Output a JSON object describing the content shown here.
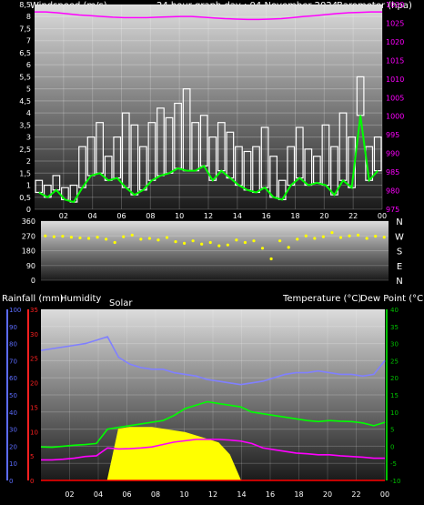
{
  "colors": {
    "background": "#000000",
    "wind_avg": "#00ff00",
    "wind_gust": "#ffffff",
    "barometer": "#ff00ff",
    "wind_dir": "#ffff00",
    "rain_axis": "#5c6cff",
    "humidity_axis": "#ff2020",
    "temp_axis": "#00c000",
    "temperature": "#00ff00",
    "dew_point": "#ff00ff",
    "humidity": "#8080ff",
    "solar": "#ffff00",
    "rain": "#ff0000",
    "grid": "#ffffff"
  },
  "header": {
    "wind_label": "Windspeed (m/s)",
    "graph_title": "24 hour graph day : 04 November 2024",
    "baro_label": "Barometer (hpa)"
  },
  "middle": {
    "rain_label": "Rainfall (mm)",
    "humidity_label": "Humidity",
    "solar_label": "Solar",
    "temp_label": "Temperature (°C)",
    "dew_label": "Dew Point (°C)"
  },
  "chart_data": [
    {
      "type": "line",
      "title": "24 hour graph day : 04 November 2024",
      "x_ticks": [
        "02",
        "04",
        "06",
        "08",
        "10",
        "12",
        "14",
        "16",
        "18",
        "20",
        "22",
        "00"
      ],
      "y_left": {
        "label": "Windspeed (m/s)",
        "range": [
          0,
          8.5
        ],
        "ticks": [
          "0",
          "0,5",
          "1",
          "1,5",
          "2",
          "2,5",
          "3",
          "3,5",
          "4",
          "4,5",
          "5",
          "5,5",
          "6",
          "6,5",
          "7",
          "7,5",
          "8",
          "8,5"
        ]
      },
      "y_right": {
        "label": "Barometer (hpa)",
        "range": [
          975,
          1030
        ],
        "ticks": [
          "975",
          "980",
          "985",
          "990",
          "995",
          "1000",
          "1005",
          "1010",
          "1015",
          "1020",
          "1025",
          "1030"
        ]
      },
      "series": [
        {
          "name": "gust",
          "axis": "left",
          "values": [
            1.2,
            1.0,
            1.4,
            0.9,
            1.0,
            2.6,
            3.0,
            3.6,
            2.2,
            3.0,
            4.0,
            3.5,
            2.6,
            3.6,
            4.2,
            3.8,
            4.4,
            5.0,
            3.6,
            3.9,
            3.0,
            3.6,
            3.2,
            2.6,
            2.4,
            2.6,
            3.4,
            2.2,
            1.2,
            2.6,
            3.4,
            2.5,
            2.2,
            3.5,
            2.6,
            4.0,
            3.0,
            5.5,
            2.6,
            3.0
          ]
        },
        {
          "name": "average",
          "axis": "left",
          "values": [
            0.7,
            0.5,
            0.8,
            0.4,
            0.3,
            0.9,
            1.4,
            1.5,
            1.2,
            1.3,
            0.9,
            0.6,
            0.8,
            1.2,
            1.4,
            1.5,
            1.7,
            1.6,
            1.6,
            1.8,
            1.2,
            1.6,
            1.3,
            1.0,
            0.8,
            0.7,
            0.9,
            0.5,
            0.4,
            1.0,
            1.3,
            1.0,
            1.1,
            1.0,
            0.6,
            1.2,
            0.9,
            3.9,
            1.2,
            1.6
          ]
        },
        {
          "name": "barometer",
          "axis": "right",
          "values": [
            1028,
            1028,
            1027.8,
            1027.5,
            1027.2,
            1027,
            1026.8,
            1026.6,
            1026.5,
            1026.5,
            1026.5,
            1026.6,
            1026.7,
            1026.8,
            1026.8,
            1026.6,
            1026.4,
            1026.2,
            1026.1,
            1026.0,
            1026.0,
            1026.1,
            1026.2,
            1026.5,
            1026.8,
            1027.0,
            1027.3,
            1027.6,
            1027.8,
            1027.9,
            1028.0,
            1028.0
          ]
        }
      ]
    },
    {
      "type": "scatter",
      "x_ticks": [
        "02",
        "04",
        "06",
        "08",
        "10",
        "12",
        "14",
        "16",
        "18",
        "20",
        "22",
        "00"
      ],
      "y_left": {
        "range": [
          0,
          360
        ],
        "ticks": [
          "0",
          "90",
          "180",
          "270",
          "360"
        ]
      },
      "y_right_labels": [
        "N",
        "W",
        "S",
        "E",
        "N"
      ],
      "series": [
        {
          "name": "wind direction",
          "values": [
            270,
            265,
            268,
            262,
            258,
            255,
            262,
            250,
            230,
            265,
            275,
            250,
            255,
            245,
            260,
            235,
            225,
            240,
            220,
            230,
            210,
            215,
            245,
            230,
            240,
            195,
            130,
            240,
            200,
            250,
            270,
            255,
            265,
            290,
            260,
            270,
            275,
            255,
            268,
            262
          ]
        }
      ]
    },
    {
      "type": "line",
      "x_ticks": [
        "02",
        "04",
        "06",
        "08",
        "10",
        "12",
        "14",
        "16",
        "18",
        "20",
        "22",
        "00"
      ],
      "y_axes": [
        {
          "label": "Rainfall (mm)",
          "range": [
            0,
            100
          ],
          "ticks": [
            "0",
            "10",
            "20",
            "30",
            "40",
            "50",
            "60",
            "70",
            "80",
            "90",
            "100"
          ]
        },
        {
          "label": "Humidity",
          "range": [
            0,
            35
          ],
          "ticks": [
            "0",
            "5",
            "10",
            "15",
            "20",
            "25",
            "30",
            "35"
          ]
        },
        {
          "label": "Temperature (°C)",
          "range": [
            -10,
            40
          ],
          "ticks": [
            "-10",
            "-5",
            "0",
            "5",
            "10",
            "15",
            "20",
            "25",
            "30",
            "35",
            "40"
          ]
        }
      ],
      "series": [
        {
          "name": "humidity",
          "values": [
            76,
            77,
            78,
            79,
            80,
            82,
            84,
            72,
            68,
            66,
            65,
            65,
            63,
            62,
            61,
            59,
            58,
            57,
            56,
            57,
            58,
            60,
            62,
            63,
            63,
            64,
            63,
            62,
            62,
            61,
            62,
            70
          ]
        },
        {
          "name": "temperature",
          "values": [
            -0.2,
            -0.3,
            0.0,
            0.3,
            0.5,
            0.8,
            5.0,
            5.5,
            6.0,
            6.5,
            7.0,
            7.5,
            9.0,
            11.0,
            12.0,
            13.0,
            12.5,
            12.0,
            11.5,
            10.0,
            9.5,
            9.0,
            8.5,
            8.0,
            7.5,
            7.2,
            7.5,
            7.3,
            7.2,
            6.8,
            6.0,
            7.0
          ]
        },
        {
          "name": "dew point",
          "values": [
            -4.0,
            -4.0,
            -3.8,
            -3.5,
            -3.0,
            -2.8,
            -0.5,
            -0.8,
            -0.7,
            -0.5,
            -0.2,
            0.5,
            1.2,
            1.6,
            2.0,
            2.0,
            2.0,
            1.8,
            1.5,
            0.8,
            -0.5,
            -1.0,
            -1.5,
            -2.0,
            -2.2,
            -2.5,
            -2.5,
            -2.8,
            -3.0,
            -3.2,
            -3.5,
            -3.5
          ]
        },
        {
          "name": "solar",
          "values": [
            0,
            0,
            0,
            0,
            0,
            0,
            0,
            30,
            31,
            31,
            31,
            30,
            29,
            28,
            26,
            24,
            22,
            15,
            0,
            0,
            0,
            0,
            0,
            0,
            0,
            0,
            0,
            0,
            0,
            0,
            0,
            0
          ]
        },
        {
          "name": "rain",
          "values": [
            0,
            0,
            0,
            0,
            0,
            0,
            0,
            0,
            0,
            0,
            0,
            0,
            0,
            0,
            0,
            0,
            0,
            0,
            0,
            0,
            0,
            0,
            0,
            0,
            0,
            0,
            0,
            0,
            0,
            0,
            0,
            0
          ]
        }
      ]
    }
  ]
}
